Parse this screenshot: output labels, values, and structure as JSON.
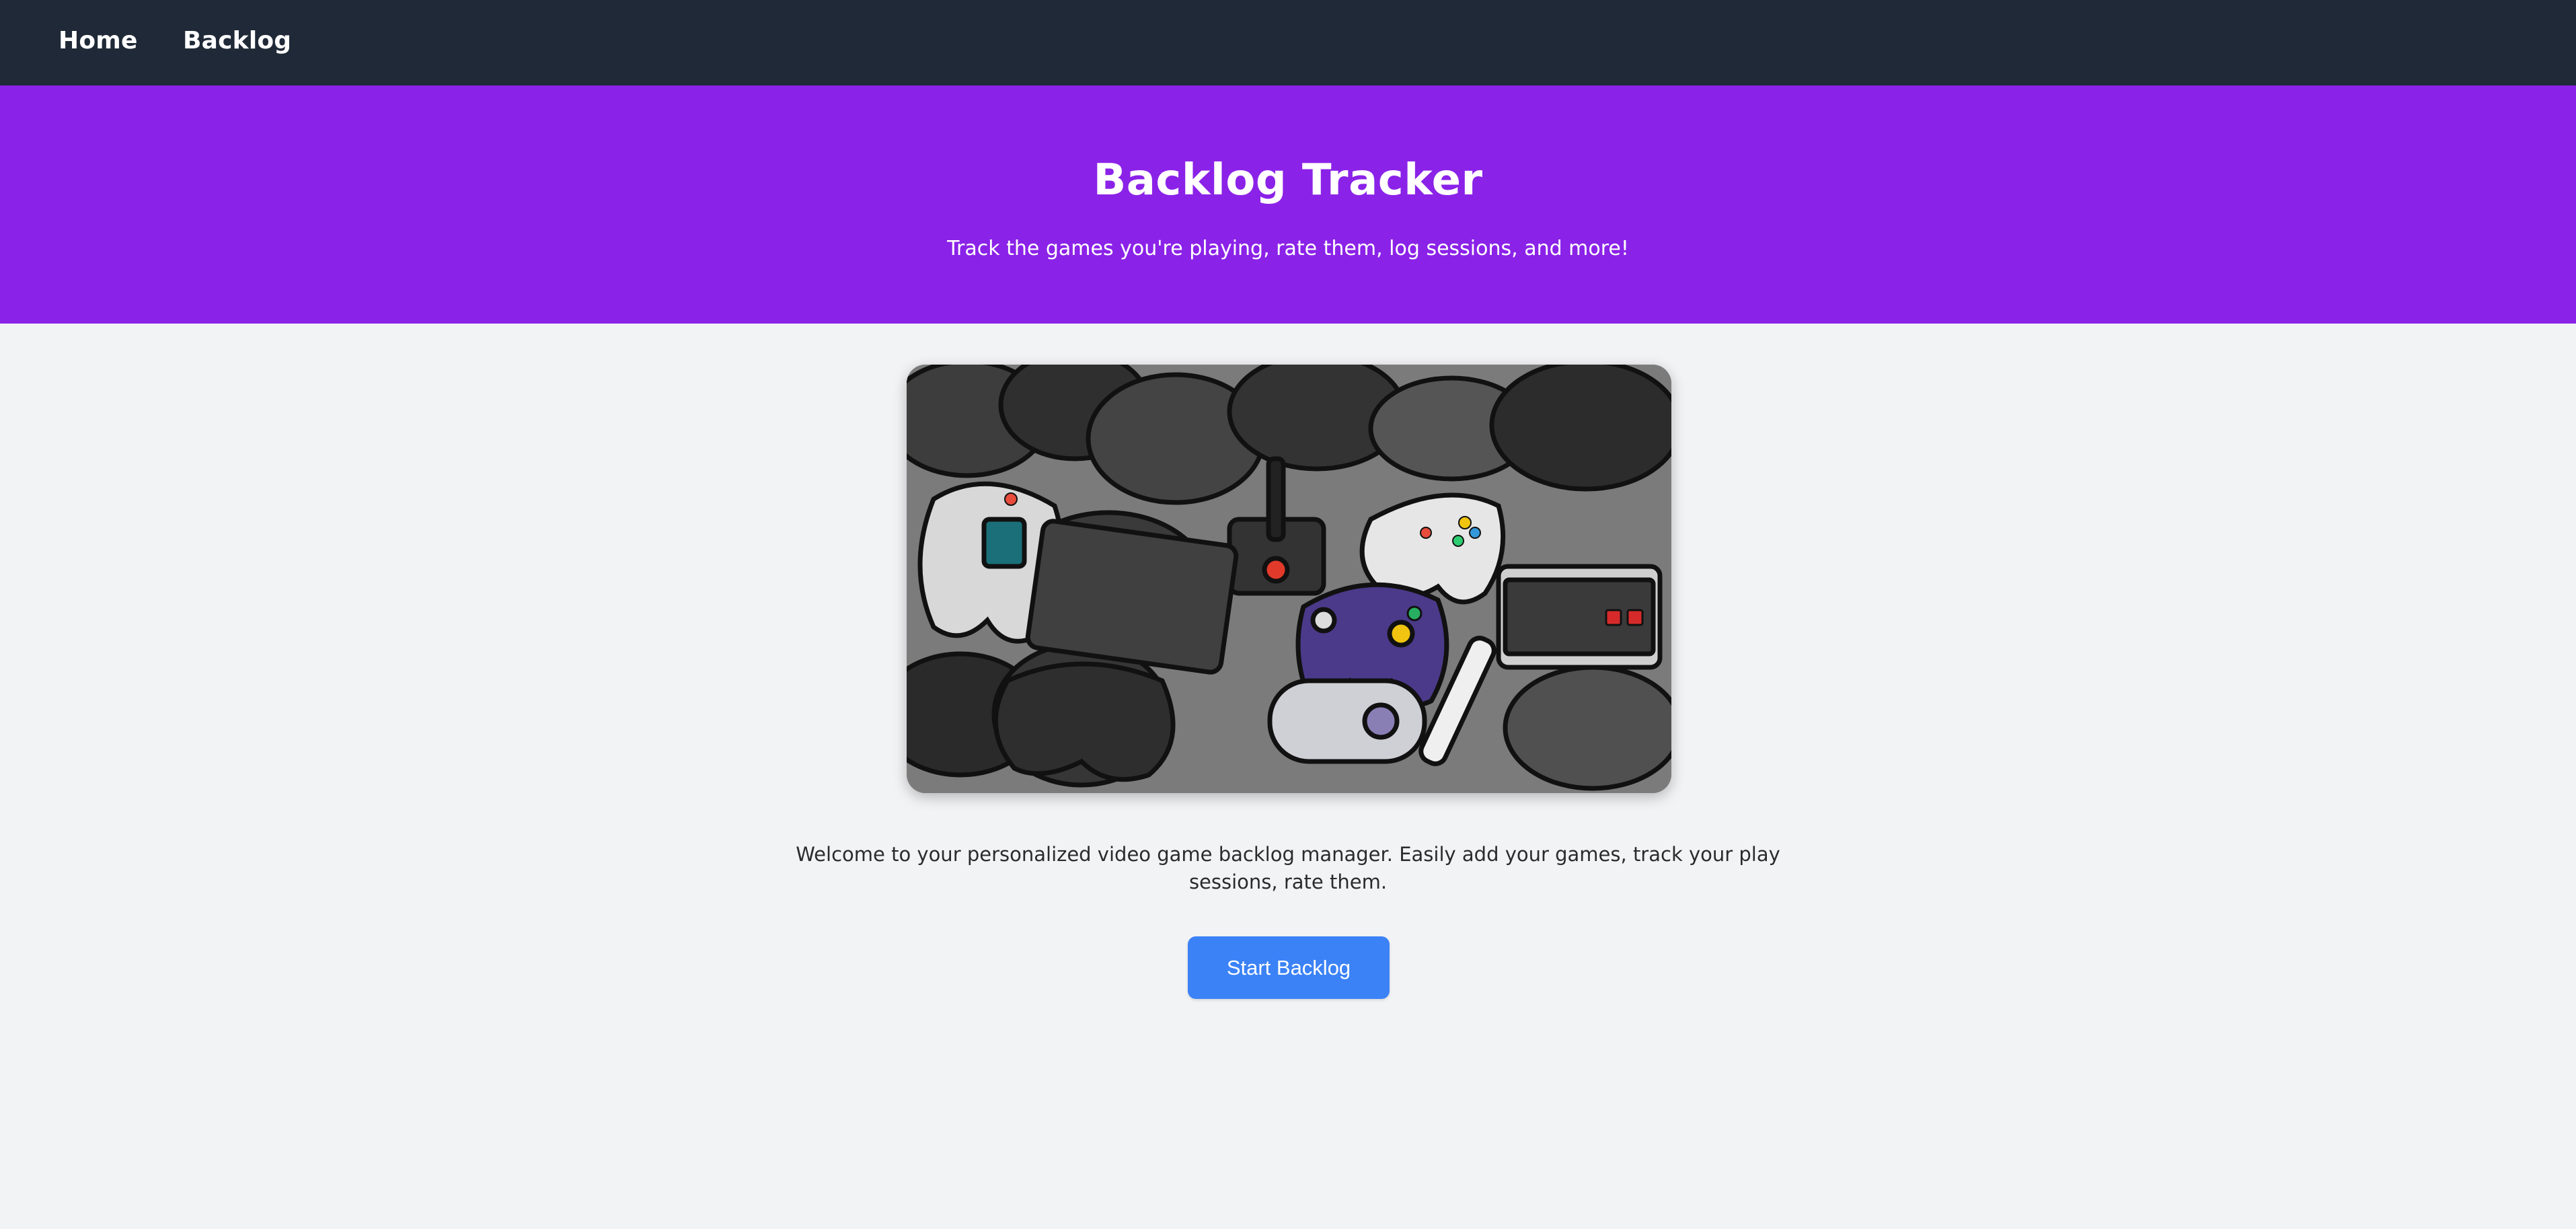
{
  "nav": {
    "home_label": "Home",
    "backlog_label": "Backlog"
  },
  "hero": {
    "title": "Backlog Tracker",
    "subtitle": "Track the games you're playing, rate them, log sessions, and more!"
  },
  "main": {
    "image_alt": "Collage of video game controllers",
    "welcome_text": "Welcome to your personalized video game backlog manager. Easily add your games, track your play sessions, rate them.",
    "start_button_label": "Start Backlog"
  },
  "colors": {
    "nav_bg": "#1f2937",
    "hero_bg": "#8b22e8",
    "page_bg": "#f2f3f5",
    "button_bg": "#3b82f6"
  }
}
